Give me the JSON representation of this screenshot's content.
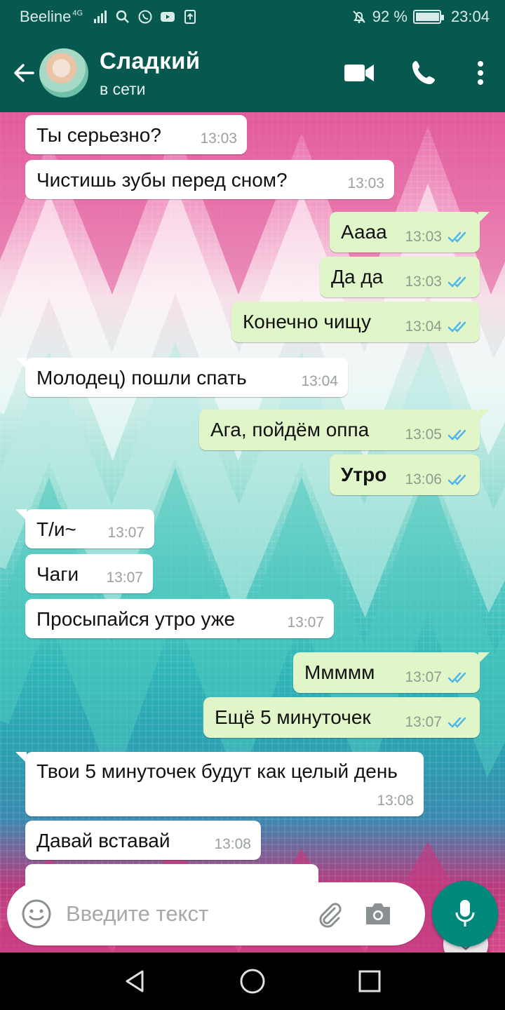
{
  "status_bar": {
    "carrier": "Beeline",
    "network": "4G",
    "battery": "92 %",
    "battery_level": 0.92,
    "time": "23:04"
  },
  "header": {
    "contact_name": "Сладкий",
    "contact_status": "в сети"
  },
  "messages": [
    {
      "dir": "in",
      "text": "Ты серьезно?",
      "time": "13:03"
    },
    {
      "dir": "in",
      "text": "Чистишь зубы перед сном?",
      "time": "13:03"
    },
    {
      "dir": "out",
      "text": "Аааа",
      "time": "13:03"
    },
    {
      "dir": "out",
      "text": "Да да",
      "time": "13:03"
    },
    {
      "dir": "out",
      "text": "Конечно чищу",
      "time": "13:04"
    },
    {
      "dir": "in",
      "text": "Молодец) пошли спать",
      "time": "13:04"
    },
    {
      "dir": "out",
      "text": "Ага, пойдём оппа",
      "time": "13:05"
    },
    {
      "dir": "out",
      "text": "Утро",
      "time": "13:06"
    },
    {
      "dir": "in",
      "text": "Т/и~",
      "time": "13:07"
    },
    {
      "dir": "in",
      "text": "Чаги",
      "time": "13:07"
    },
    {
      "dir": "in",
      "text": "Просыпайся утро уже",
      "time": "13:07"
    },
    {
      "dir": "out",
      "text": "Ммммм",
      "time": "13:07"
    },
    {
      "dir": "out",
      "text": "Ещё 5 минуточек",
      "time": "13:07"
    },
    {
      "dir": "in",
      "text": "Твои 5 минуточек будут как целый день",
      "time": "13:08"
    },
    {
      "dir": "in",
      "text": "Давай вставай",
      "time": "13:08"
    }
  ],
  "composer": {
    "placeholder": "Введите текст"
  },
  "icons": {
    "back": "arrow-back-icon",
    "video": "video-camera-icon",
    "call": "phone-icon",
    "menu": "more-vert-icon",
    "emoji": "emoji-icon",
    "attach": "paperclip-icon",
    "camera": "camera-icon",
    "mic": "microphone-icon",
    "scroll": "double-chevron-down-icon"
  },
  "colors": {
    "header": "#07584f",
    "outgoing_bubble": "#e1f6c8",
    "incoming_bubble": "#ffffff",
    "read_ticks": "#4fb6ec",
    "mic_button": "#00897b"
  }
}
